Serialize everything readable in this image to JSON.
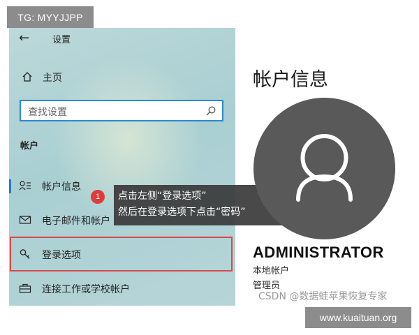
{
  "watermark": {
    "tg_tag": "TG: MYYJJPP",
    "csdn": "CSDN @数据蛙苹果恢复专家",
    "site": "www.kuaituan.org"
  },
  "settings": {
    "title": "设置",
    "home_label": "主页",
    "search_placeholder": "查找设置",
    "section_header": "帐户",
    "nav_items": [
      {
        "label": "帐户信息",
        "icon": "account-info-icon"
      },
      {
        "label": "电子邮件和帐户",
        "icon": "mail-icon"
      },
      {
        "label": "登录选项",
        "icon": "key-icon"
      },
      {
        "label": "连接工作或学校帐户",
        "icon": "briefcase-icon"
      }
    ]
  },
  "callout": {
    "badge": "1",
    "line1": "点击左侧“登录选项”",
    "line2": "然后在登录选项下点击“密码”"
  },
  "account": {
    "title": "帐户信息",
    "name": "ADMINISTRATOR",
    "type": "本地帐户",
    "role": "管理员"
  },
  "colors": {
    "sidebar_bg": "#b3d3d6",
    "search_border": "#2a8ad2",
    "highlight_border": "#d64a4a",
    "badge": "#e03b3b",
    "avatar_bg": "#595959"
  }
}
